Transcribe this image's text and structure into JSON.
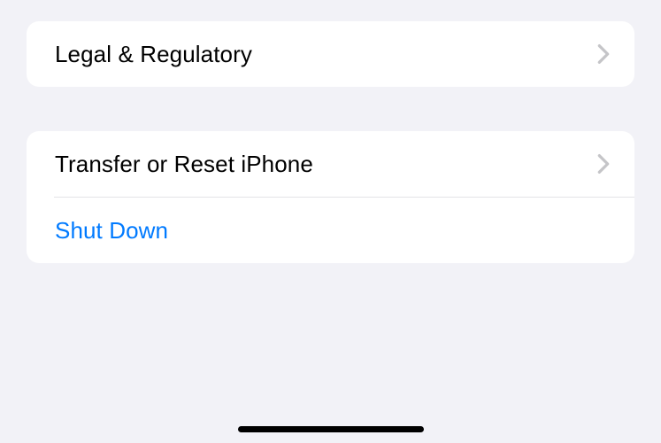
{
  "groups": [
    {
      "rows": [
        {
          "label": "Legal & Regulatory",
          "style": "default",
          "disclosure": true
        }
      ]
    },
    {
      "rows": [
        {
          "label": "Transfer or Reset iPhone",
          "style": "default",
          "disclosure": true
        },
        {
          "label": "Shut Down",
          "style": "blue",
          "disclosure": false
        }
      ]
    }
  ]
}
